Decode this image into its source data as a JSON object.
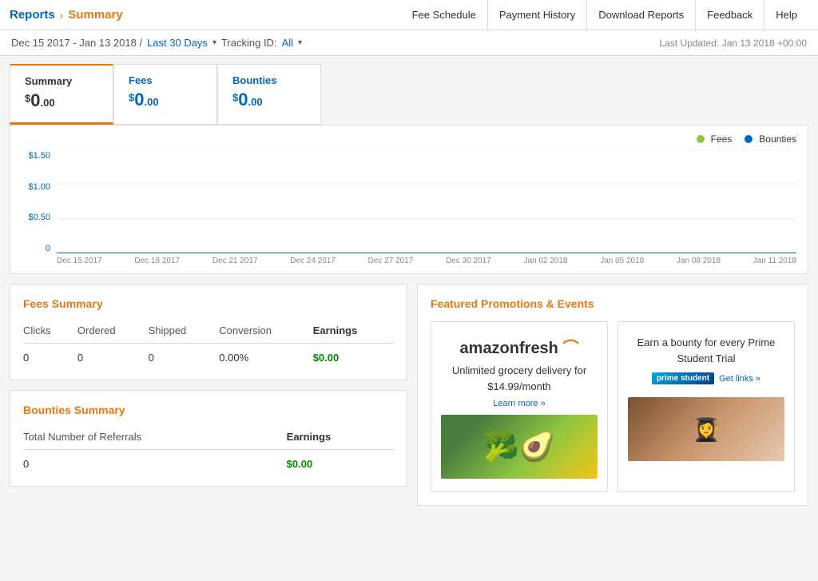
{
  "topNav": {
    "reportsLabel": "Reports",
    "chevron": "›",
    "summaryLabel": "Summary",
    "navButtons": [
      {
        "label": "Fee Schedule",
        "name": "fee-schedule"
      },
      {
        "label": "Payment History",
        "name": "payment-history"
      },
      {
        "label": "Download Reports",
        "name": "download-reports"
      },
      {
        "label": "Feedback",
        "name": "feedback"
      },
      {
        "label": "Help",
        "name": "help"
      }
    ]
  },
  "dateBar": {
    "dateRange": "Dec 15 2017 - Jan 13 2018 /",
    "last30Days": "Last 30 Days",
    "trackingLabel": "Tracking ID:",
    "trackingValue": "All",
    "lastUpdated": "Last Updated: Jan 13 2018 +00:00"
  },
  "summaryCards": [
    {
      "title": "Summary",
      "superscript": "$",
      "whole": "0",
      "decimal": ".00",
      "active": true,
      "titleColor": "orange",
      "valueColor": "dark"
    },
    {
      "title": "Fees",
      "superscript": "$",
      "whole": "0",
      "decimal": ".00",
      "active": false,
      "titleColor": "blue",
      "valueColor": "blue"
    },
    {
      "title": "Bounties",
      "superscript": "$",
      "whole": "0",
      "decimal": ".00",
      "active": false,
      "titleColor": "blue",
      "valueColor": "blue"
    }
  ],
  "chart": {
    "legend": {
      "fees": "Fees",
      "bounties": "Bounties",
      "feesColor": "#8dc63f",
      "bountiesColor": "#0066c0"
    },
    "yLabels": [
      "$1.50",
      "$1.00",
      "$0.50",
      "0"
    ],
    "xLabels": [
      "Dec 15 2017",
      "Dec 18 2017",
      "Dec 21 2017",
      "Dec 24 2017",
      "Dec 27 2017",
      "Dec 30 2017",
      "Jan 02 2018",
      "Jan 05 2018",
      "Jan 08 2018",
      "Jan 11 2018"
    ]
  },
  "feesSummary": {
    "title": "Fees Summary",
    "columns": [
      "Clicks",
      "Ordered",
      "Shipped",
      "Conversion",
      "Earnings"
    ],
    "values": [
      "0",
      "0",
      "0",
      "0.00%",
      "$0.00"
    ]
  },
  "bountiesSummary": {
    "title": "Bounties Summary",
    "col1": "Total Number of Referrals",
    "col2": "Earnings",
    "val1": "0",
    "val2": "$0.00"
  },
  "featuredPromotions": {
    "title": "Featured Promotions & Events",
    "promos": [
      {
        "logoText": "amazonfresh",
        "description": "Unlimited grocery delivery for $14.99/month",
        "subtext": "Learn more »"
      },
      {
        "headline": "Earn a bounty for every Prime Student Trial",
        "badgeLabel": "prime student",
        "linkText": "Get links »"
      }
    ]
  }
}
